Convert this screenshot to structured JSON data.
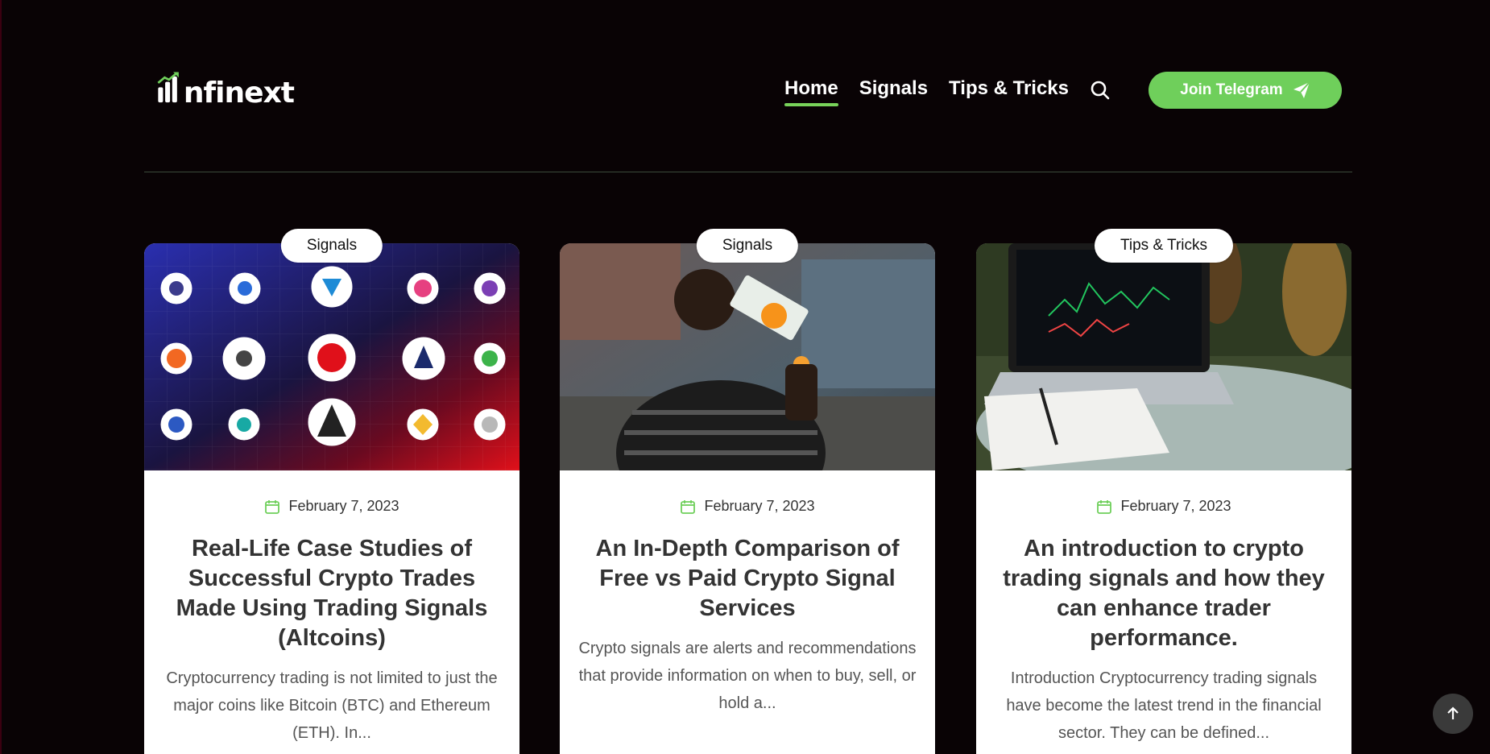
{
  "brand": {
    "name": "nfinext"
  },
  "nav": {
    "items": [
      {
        "label": "Home",
        "active": true
      },
      {
        "label": "Signals",
        "active": false
      },
      {
        "label": "Tips & Tricks",
        "active": false
      }
    ],
    "cta_label": "Join Telegram"
  },
  "colors": {
    "accent": "#6fcf5b",
    "background": "#090305",
    "card": "#ffffff"
  },
  "posts": [
    {
      "category": "Signals",
      "date": "February 7, 2023",
      "title": "Real-Life Case Studies of Successful Crypto Trades Made Using Trading Signals (Altcoins)",
      "excerpt": "Cryptocurrency trading is not limited to just the major coins like Bitcoin (BTC) and Ethereum (ETH). In..."
    },
    {
      "category": "Signals",
      "date": "February 7, 2023",
      "title": "An In-Depth Comparison of Free vs Paid Crypto Signal Services",
      "excerpt": "Crypto signals are alerts and recommendations that provide information on when to buy, sell, or hold a..."
    },
    {
      "category": "Tips & Tricks",
      "date": "February 7, 2023",
      "title": "An introduction to crypto trading signals and how they can enhance trader performance.",
      "excerpt": "Introduction Cryptocurrency trading signals have become the latest trend in the financial sector. They can be defined..."
    }
  ],
  "icons": {
    "search": "search-icon",
    "send": "paper-plane-icon",
    "calendar": "calendar-icon",
    "back_to_top": "arrow-up-icon"
  }
}
